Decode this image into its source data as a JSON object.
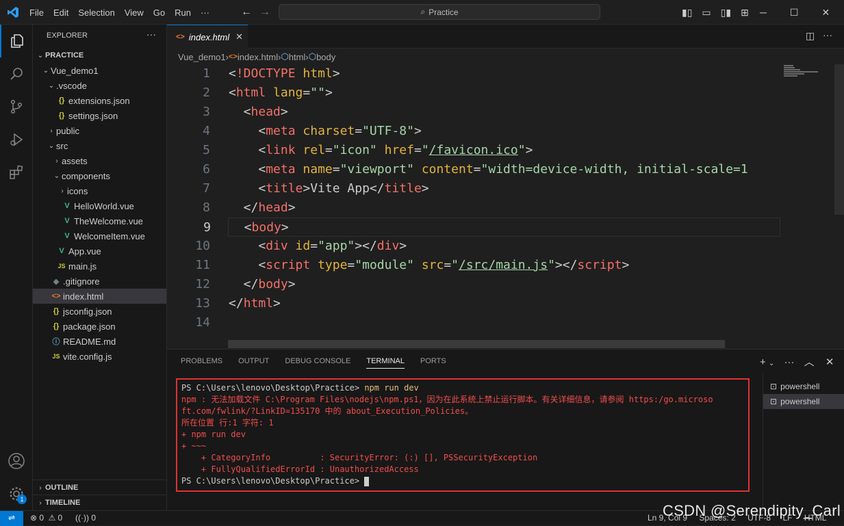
{
  "menu": [
    "File",
    "Edit",
    "Selection",
    "View",
    "Go",
    "Run",
    "···"
  ],
  "search": {
    "placeholder": "Practice"
  },
  "sidebar": {
    "title": "EXPLORER",
    "more": "···",
    "root": "PRACTICE",
    "items": [
      {
        "label": "Vue_demo1",
        "type": "folder",
        "open": true,
        "depth": 1
      },
      {
        "label": ".vscode",
        "type": "folder",
        "open": true,
        "depth": 2
      },
      {
        "label": "extensions.json",
        "type": "json",
        "depth": 3
      },
      {
        "label": "settings.json",
        "type": "json",
        "depth": 3
      },
      {
        "label": "public",
        "type": "folder",
        "open": false,
        "depth": 2
      },
      {
        "label": "src",
        "type": "folder",
        "open": true,
        "depth": 2
      },
      {
        "label": "assets",
        "type": "folder",
        "open": false,
        "depth": 3
      },
      {
        "label": "components",
        "type": "folder",
        "open": true,
        "depth": 3
      },
      {
        "label": "icons",
        "type": "folder",
        "open": false,
        "depth": 4
      },
      {
        "label": "HelloWorld.vue",
        "type": "vue",
        "depth": 4
      },
      {
        "label": "TheWelcome.vue",
        "type": "vue",
        "depth": 4
      },
      {
        "label": "WelcomeItem.vue",
        "type": "vue",
        "depth": 4
      },
      {
        "label": "App.vue",
        "type": "vue",
        "depth": 3
      },
      {
        "label": "main.js",
        "type": "js",
        "depth": 3
      },
      {
        "label": ".gitignore",
        "type": "git",
        "depth": 2
      },
      {
        "label": "index.html",
        "type": "html",
        "depth": 2,
        "selected": true
      },
      {
        "label": "jsconfig.json",
        "type": "json",
        "depth": 2
      },
      {
        "label": "package.json",
        "type": "json",
        "depth": 2
      },
      {
        "label": "README.md",
        "type": "info",
        "depth": 2
      },
      {
        "label": "vite.config.js",
        "type": "js",
        "depth": 2
      }
    ],
    "outline": "OUTLINE",
    "timeline": "TIMELINE"
  },
  "editor": {
    "tab_label": "index.html",
    "breadcrumb": [
      "Vue_demo1",
      "index.html",
      "html",
      "body"
    ],
    "lines": [
      {
        "n": "1",
        "tokens": [
          [
            "t-punc",
            "<"
          ],
          [
            "t-doc",
            "!DOCTYPE"
          ],
          [
            "t-punc",
            " "
          ],
          [
            "t-attr",
            "html"
          ],
          [
            "t-punc",
            ">"
          ]
        ]
      },
      {
        "n": "2",
        "tokens": [
          [
            "t-punc",
            "<"
          ],
          [
            "t-tag",
            "html"
          ],
          [
            "t-punc",
            " "
          ],
          [
            "t-attr",
            "lang"
          ],
          [
            "t-punc",
            "="
          ],
          [
            "t-str",
            "\"\""
          ],
          [
            "t-punc",
            ">"
          ]
        ]
      },
      {
        "n": "3",
        "tokens": [
          [
            "t-punc",
            "  <"
          ],
          [
            "t-tag",
            "head"
          ],
          [
            "t-punc",
            ">"
          ]
        ]
      },
      {
        "n": "4",
        "tokens": [
          [
            "t-punc",
            "    <"
          ],
          [
            "t-tag",
            "meta"
          ],
          [
            "t-punc",
            " "
          ],
          [
            "t-attr",
            "charset"
          ],
          [
            "t-punc",
            "="
          ],
          [
            "t-str",
            "\"UTF-8\""
          ],
          [
            "t-punc",
            ">"
          ]
        ]
      },
      {
        "n": "5",
        "tokens": [
          [
            "t-punc",
            "    <"
          ],
          [
            "t-tag",
            "link"
          ],
          [
            "t-punc",
            " "
          ],
          [
            "t-attr",
            "rel"
          ],
          [
            "t-punc",
            "="
          ],
          [
            "t-str",
            "\"icon\""
          ],
          [
            "t-punc",
            " "
          ],
          [
            "t-attr",
            "href"
          ],
          [
            "t-punc",
            "="
          ],
          [
            "t-str",
            "\""
          ],
          [
            "t-link",
            "/favicon.ico"
          ],
          [
            "t-str",
            "\""
          ],
          [
            "t-punc",
            ">"
          ]
        ]
      },
      {
        "n": "6",
        "tokens": [
          [
            "t-punc",
            "    <"
          ],
          [
            "t-tag",
            "meta"
          ],
          [
            "t-punc",
            " "
          ],
          [
            "t-attr",
            "name"
          ],
          [
            "t-punc",
            "="
          ],
          [
            "t-str",
            "\"viewport\""
          ],
          [
            "t-punc",
            " "
          ],
          [
            "t-attr",
            "content"
          ],
          [
            "t-punc",
            "="
          ],
          [
            "t-str",
            "\"width=device-width, initial-scale=1"
          ]
        ]
      },
      {
        "n": "7",
        "tokens": [
          [
            "t-punc",
            "    <"
          ],
          [
            "t-tag",
            "title"
          ],
          [
            "t-punc",
            ">Vite App</"
          ],
          [
            "t-tag",
            "title"
          ],
          [
            "t-punc",
            ">"
          ]
        ]
      },
      {
        "n": "8",
        "tokens": [
          [
            "t-punc",
            "  </"
          ],
          [
            "t-tag",
            "head"
          ],
          [
            "t-punc",
            ">"
          ]
        ]
      },
      {
        "n": "9",
        "tokens": [
          [
            "t-punc",
            "  <"
          ],
          [
            "t-tag",
            "body"
          ],
          [
            "t-punc",
            ">"
          ]
        ]
      },
      {
        "n": "10",
        "tokens": [
          [
            "t-punc",
            "    <"
          ],
          [
            "t-tag",
            "div"
          ],
          [
            "t-punc",
            " "
          ],
          [
            "t-attr",
            "id"
          ],
          [
            "t-punc",
            "="
          ],
          [
            "t-str",
            "\"app\""
          ],
          [
            "t-punc",
            "></"
          ],
          [
            "t-tag",
            "div"
          ],
          [
            "t-punc",
            ">"
          ]
        ]
      },
      {
        "n": "11",
        "tokens": [
          [
            "t-punc",
            "    <"
          ],
          [
            "t-tag",
            "script"
          ],
          [
            "t-punc",
            " "
          ],
          [
            "t-attr",
            "type"
          ],
          [
            "t-punc",
            "="
          ],
          [
            "t-str",
            "\"module\""
          ],
          [
            "t-punc",
            " "
          ],
          [
            "t-attr",
            "src"
          ],
          [
            "t-punc",
            "="
          ],
          [
            "t-str",
            "\""
          ],
          [
            "t-link",
            "/src/main.js"
          ],
          [
            "t-str",
            "\""
          ],
          [
            "t-punc",
            "></"
          ],
          [
            "t-tag",
            "script"
          ],
          [
            "t-punc",
            ">"
          ]
        ]
      },
      {
        "n": "12",
        "tokens": [
          [
            "t-punc",
            "  </"
          ],
          [
            "t-tag",
            "body"
          ],
          [
            "t-punc",
            ">"
          ]
        ]
      },
      {
        "n": "13",
        "tokens": [
          [
            "t-punc",
            "</"
          ],
          [
            "t-tag",
            "html"
          ],
          [
            "t-punc",
            ">"
          ]
        ]
      },
      {
        "n": "14",
        "tokens": []
      }
    ],
    "current_line": "9"
  },
  "panel": {
    "tabs": [
      "PROBLEMS",
      "OUTPUT",
      "DEBUG CONSOLE",
      "TERMINAL",
      "PORTS"
    ],
    "active_tab": "TERMINAL",
    "terminal_lines": [
      {
        "text": "PS C:\\Users\\lenovo\\Desktop\\Practice> ",
        "cmd": "npm run dev",
        "kind": "ok"
      },
      {
        "text": "npm : 无法加载文件 C:\\Program Files\\nodejs\\npm.ps1，因为在此系统上禁止运行脚本。有关详细信息，请参阅 https:/go.microso",
        "kind": "err"
      },
      {
        "text": "ft.com/fwlink/?LinkID=135170 中的 about_Execution_Policies。",
        "kind": "err"
      },
      {
        "text": "所在位置 行:1 字符: 1",
        "kind": "err"
      },
      {
        "text": "+ npm run dev",
        "kind": "err"
      },
      {
        "text": "+ ~~~",
        "kind": "err"
      },
      {
        "text": "    + CategoryInfo          : SecurityError: (:) [], PSSecurityException",
        "kind": "err"
      },
      {
        "text": "    + FullyQualifiedErrorId : UnauthorizedAccess",
        "kind": "err"
      },
      {
        "text": "PS C:\\Users\\lenovo\\Desktop\\Practice> ",
        "kind": "ok",
        "cursor": true
      }
    ],
    "shells": [
      "powershell",
      "powershell"
    ]
  },
  "status": {
    "errors": "0",
    "warnings": "0",
    "ports": "0",
    "position": "Ln 9, Col 9",
    "spaces": "Spaces: 2",
    "encoding": "UTF-8",
    "eol": "LF",
    "language": "HTML"
  },
  "watermark": "CSDN @Serendipity_Carl",
  "settings_badge": "1",
  "colors": {
    "accent": "#0078d4",
    "error": "#f14c4c",
    "highlight_border": "#e03131"
  }
}
